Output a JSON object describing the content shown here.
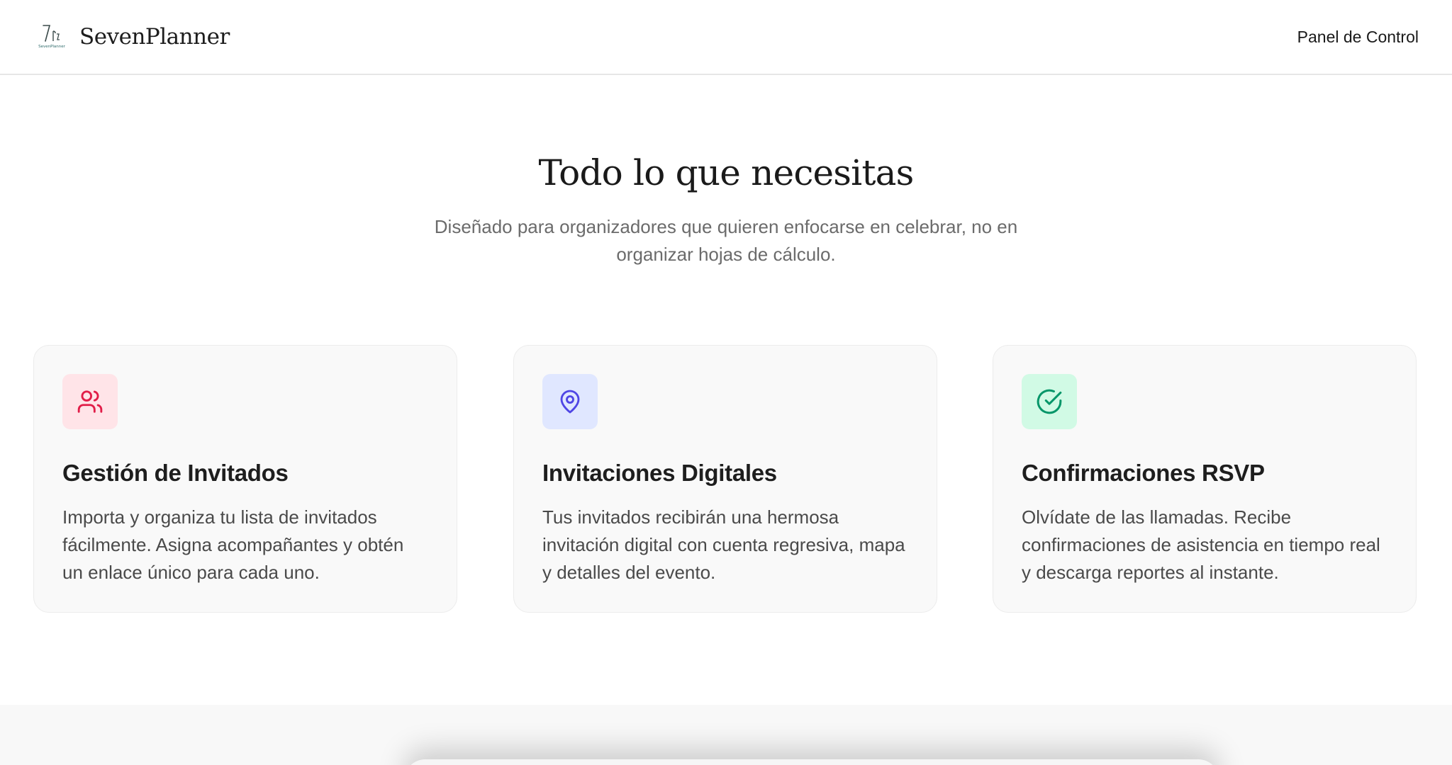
{
  "nav": {
    "brand": "SevenPlanner",
    "logo_text": "SevenPlanner",
    "link": "Panel de Control"
  },
  "hero": {
    "title": "Todo lo que necesitas",
    "subtitle": "Diseñado para organizadores que quieren enfocarse en celebrar, no en organizar hojas de cálculo."
  },
  "features": [
    {
      "icon": "users-icon",
      "accent": "#e11d48",
      "accent_bg": "#ffe4e8",
      "title": "Gestión de Invitados",
      "text": "Importa y organiza tu lista de invitados fácilmente. Asigna acompañantes y obtén un enlace único para cada uno."
    },
    {
      "icon": "map-pin-icon",
      "accent": "#4f46e5",
      "accent_bg": "#e0e7ff",
      "title": "Invitaciones Digitales",
      "text": "Tus invitados recibirán una hermosa invitación digital con cuenta regresiva, mapa y detalles del evento."
    },
    {
      "icon": "check-circle-icon",
      "accent": "#059669",
      "accent_bg": "#d1fae5",
      "title": "Confirmaciones RSVP",
      "text": "Olvídate de las llamadas. Recibe confirmaciones de asistencia en tiempo real y descarga reportes al instante."
    }
  ]
}
